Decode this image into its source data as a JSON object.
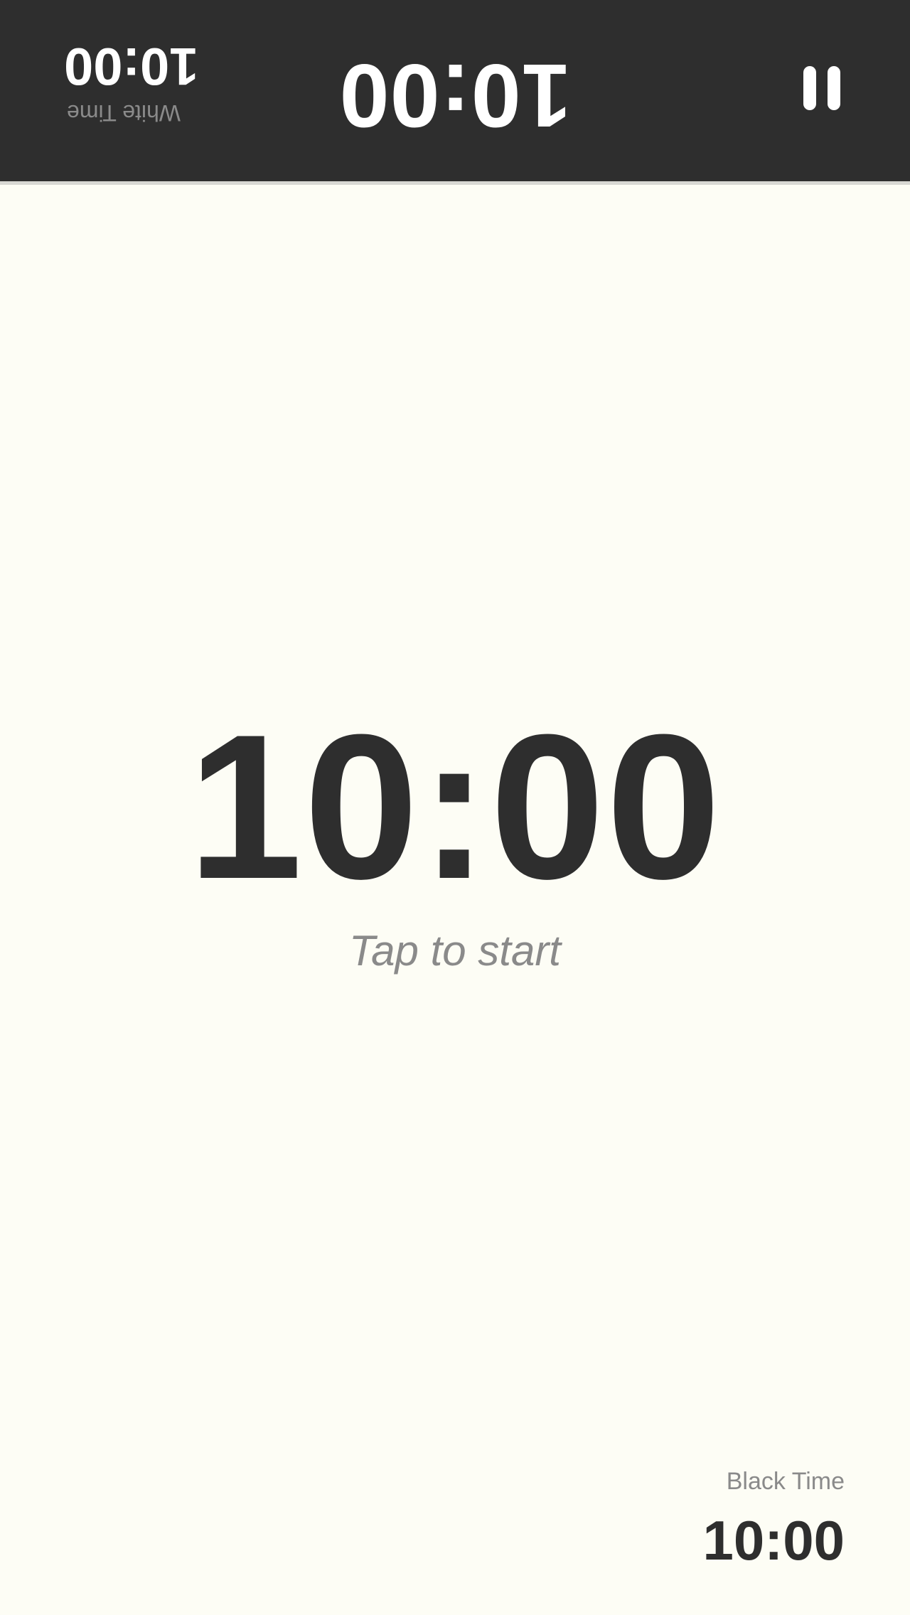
{
  "top_panel": {
    "opponent_clock": "10:00",
    "own_label": "White Time",
    "own_time": "10:00",
    "pause_icon": "pause-icon",
    "background": "#2e2e2e",
    "text_color": "#ffffff"
  },
  "main": {
    "active_clock": "10:00",
    "hint": "Tap to start",
    "own_label": "Black Time",
    "own_time": "10:00",
    "background": "#fdfdf5",
    "text_color": "#2e2e2e",
    "muted_color": "#8a8a8a"
  }
}
